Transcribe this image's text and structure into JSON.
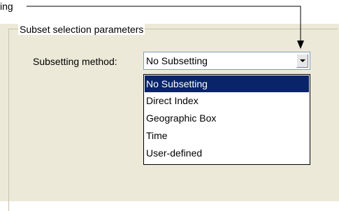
{
  "callout": {
    "text": "ing"
  },
  "group": {
    "title": "Subset selection parameters"
  },
  "field": {
    "label": "Subsetting method:",
    "value": "No Subsetting"
  },
  "dropdown": {
    "options": [
      {
        "label": "No Subsetting",
        "selected": true
      },
      {
        "label": "Direct Index",
        "selected": false
      },
      {
        "label": "Geographic Box",
        "selected": false
      },
      {
        "label": "Time",
        "selected": false
      },
      {
        "label": "User-defined",
        "selected": false
      }
    ]
  },
  "colors": {
    "panel_bg": "#ece9d8",
    "selection_bg": "#0a246a",
    "selection_fg": "#ffffff"
  },
  "icons": {
    "combo_arrow": "chevron-down-icon"
  }
}
